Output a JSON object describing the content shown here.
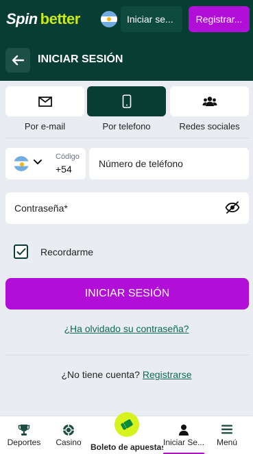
{
  "header": {
    "logo_spin": "Spin",
    "logo_better": "better",
    "login_button": "Iniciar se...",
    "register_button": "Registrar..."
  },
  "subheader": {
    "title": "INICIAR SESIÓN"
  },
  "tabs": [
    {
      "label": "Por e-mail",
      "icon": "envelope-icon",
      "active": false
    },
    {
      "label": "Por telefono",
      "icon": "phone-icon",
      "active": true
    },
    {
      "label": "Redes sociales",
      "icon": "users-icon",
      "active": false
    }
  ],
  "form": {
    "code_label": "Código",
    "code_value": "+54",
    "phone_placeholder": "Número de teléfono",
    "password_placeholder": "Contraseña*",
    "remember_label": "Recordarme",
    "remember_checked": true,
    "submit_label": "INICIAR SESIÓN",
    "forgot_link": "¿Ha olvidado su contraseña?",
    "no_account_text": "¿No tiene cuenta?",
    "register_link": "Registrarse"
  },
  "bottom_nav": [
    {
      "label": "Deportes",
      "icon": "trophy-icon"
    },
    {
      "label": "Casino",
      "icon": "chip-icon"
    },
    {
      "label": "Boleto de apuestas",
      "icon": "ticket-icon"
    },
    {
      "label": "Iniciar Se...",
      "icon": "user-icon",
      "active": true
    },
    {
      "label": "Menú",
      "icon": "menu-icon"
    }
  ],
  "colors": {
    "brand_dark": "#083d33",
    "accent_purple": "#b10fd8",
    "accent_lime": "#c8e81a",
    "link_green": "#0a6b57"
  }
}
